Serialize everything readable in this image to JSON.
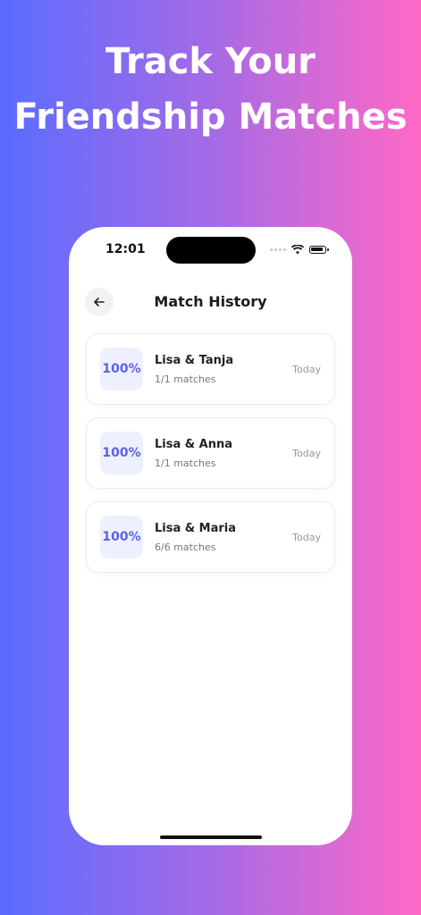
{
  "headline": {
    "line1": "Track Your",
    "line2": "Friendship Matches"
  },
  "status_bar": {
    "time": "12:01"
  },
  "header": {
    "title": "Match History"
  },
  "matches": [
    {
      "score": "100%",
      "names": "Lisa & Tanja",
      "count": "1/1 matches",
      "date": "Today"
    },
    {
      "score": "100%",
      "names": "Lisa & Anna",
      "count": "1/1 matches",
      "date": "Today"
    },
    {
      "score": "100%",
      "names": "Lisa & Maria",
      "count": "6/6 matches",
      "date": "Today"
    }
  ],
  "colors": {
    "accent": "#5c63e6",
    "score_bg": "#eeefff",
    "gradient_start": "#5a6cff",
    "gradient_end": "#ff69c6"
  },
  "icons": {
    "back": "arrow-left-icon",
    "wifi": "wifi-icon",
    "battery": "battery-icon"
  }
}
